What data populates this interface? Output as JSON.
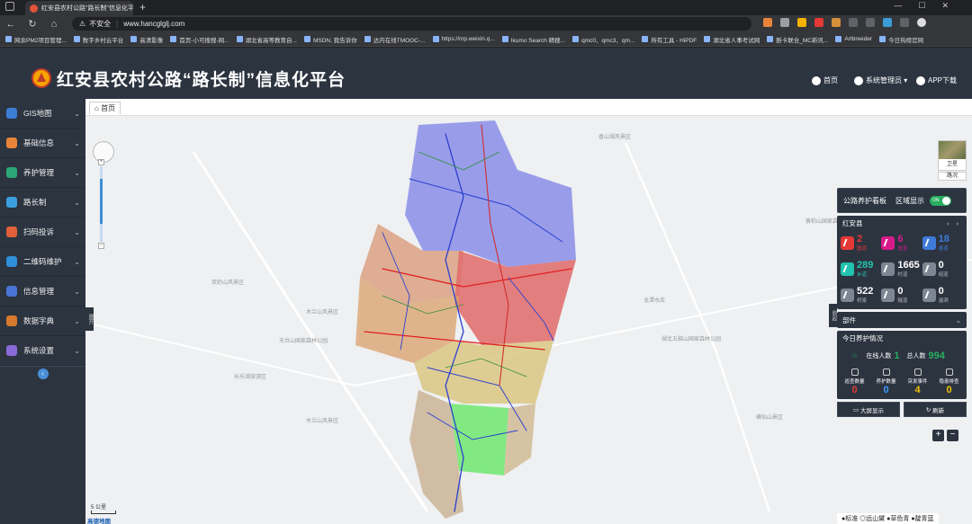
{
  "browser": {
    "tab_title": "红安县农村公路\"路长制\"信息化平",
    "security_label": "不安全",
    "url": "www.hancglglj.com",
    "bookmarks": [
      "网余PM2项目管理...",
      "数字乡村云平台",
      "高清影像",
      "首页-小可搜搜-网...",
      "湖北省高等教育自...",
      "MSDN, 我告诉你",
      "达内在线TMOOC-...",
      "https://mp.weixin.q...",
      "Ikumo Search 精搜...",
      "qmc0、qmc3、qm...",
      "所有工具 - HiPDF",
      "湖北省人事考试网",
      "断卡联合_MC新讯...",
      "Artbreeder",
      "今日热榜官网"
    ]
  },
  "app": {
    "title": "红安县农村公路“路长制”信息化平台",
    "nav": {
      "home": "首页",
      "user": "系统管理员",
      "app": "APP下载"
    }
  },
  "sidebar": {
    "items": [
      {
        "label": "GIS地图",
        "color": "#3b7ed6"
      },
      {
        "label": "基础信息",
        "color": "#e8843a"
      },
      {
        "label": "养护管理",
        "color": "#2aa876"
      },
      {
        "label": "路长制",
        "color": "#3ba0e0"
      },
      {
        "label": "扫码投诉",
        "color": "#e0603a"
      },
      {
        "label": "二维码维护",
        "color": "#2f8fd8"
      },
      {
        "label": "信息管理",
        "color": "#4a74d6"
      },
      {
        "label": "数据字典",
        "color": "#d67a2e"
      },
      {
        "label": "系统设置",
        "color": "#8a6ad8"
      }
    ]
  },
  "breadcrumb": {
    "home": "首页"
  },
  "map": {
    "labels": [
      "香山湖风景区",
      "黄柏山国家森林公园",
      "双奶山风景区",
      "木兰山风景区",
      "龙潭水库",
      "天台山国家森林公园",
      "湖北五脑山国家森林公园",
      "横仙山景区",
      "长乐湖旅游区",
      "木兰山风景区"
    ],
    "satellite": "卫星",
    "road": "路况",
    "scale": "5 公里",
    "provider": "高德地图",
    "basemaps": [
      "●标准",
      "◎远山黛",
      "●草色青",
      "●靛青蓝"
    ],
    "side_tag_left": "展开",
    "side_tag_right": "收起"
  },
  "panel": {
    "title": "公路养护看板",
    "area_label": "区域显示",
    "toggle": "ON",
    "county": "红安县",
    "stats": [
      {
        "num": "2",
        "label": "国道",
        "color": "#e53935"
      },
      {
        "num": "6",
        "label": "省道",
        "color": "#d81b8a"
      },
      {
        "num": "18",
        "label": "县道",
        "color": "#3f7bd9"
      },
      {
        "num": "289",
        "label": "乡道",
        "color": "#22c4b0"
      },
      {
        "num": "1665",
        "label": "村道",
        "color": "#ffffff"
      },
      {
        "num": "0",
        "label": "组道",
        "color": "#ffffff"
      },
      {
        "num": "522",
        "label": "桥梁",
        "color": "#ffffff"
      },
      {
        "num": "0",
        "label": "隧道",
        "color": "#ffffff"
      },
      {
        "num": "0",
        "label": "涵洞",
        "color": "#ffffff"
      }
    ],
    "department": "部件",
    "today": {
      "title": "今日养护情况",
      "online_label": "在线人数",
      "online": "1",
      "total_label": "总人数",
      "total": "994",
      "items": [
        {
          "label": "巡查数量",
          "num": "0",
          "color": "#e53935"
        },
        {
          "label": "养护数量",
          "num": "0",
          "color": "#3f9bff"
        },
        {
          "label": "突发事件",
          "num": "4",
          "color": "#f2c200"
        },
        {
          "label": "隐患排查",
          "num": "0",
          "color": "#f2c200"
        }
      ]
    },
    "btn_bigscreen": "大屏显示",
    "btn_refresh": "刷新"
  }
}
